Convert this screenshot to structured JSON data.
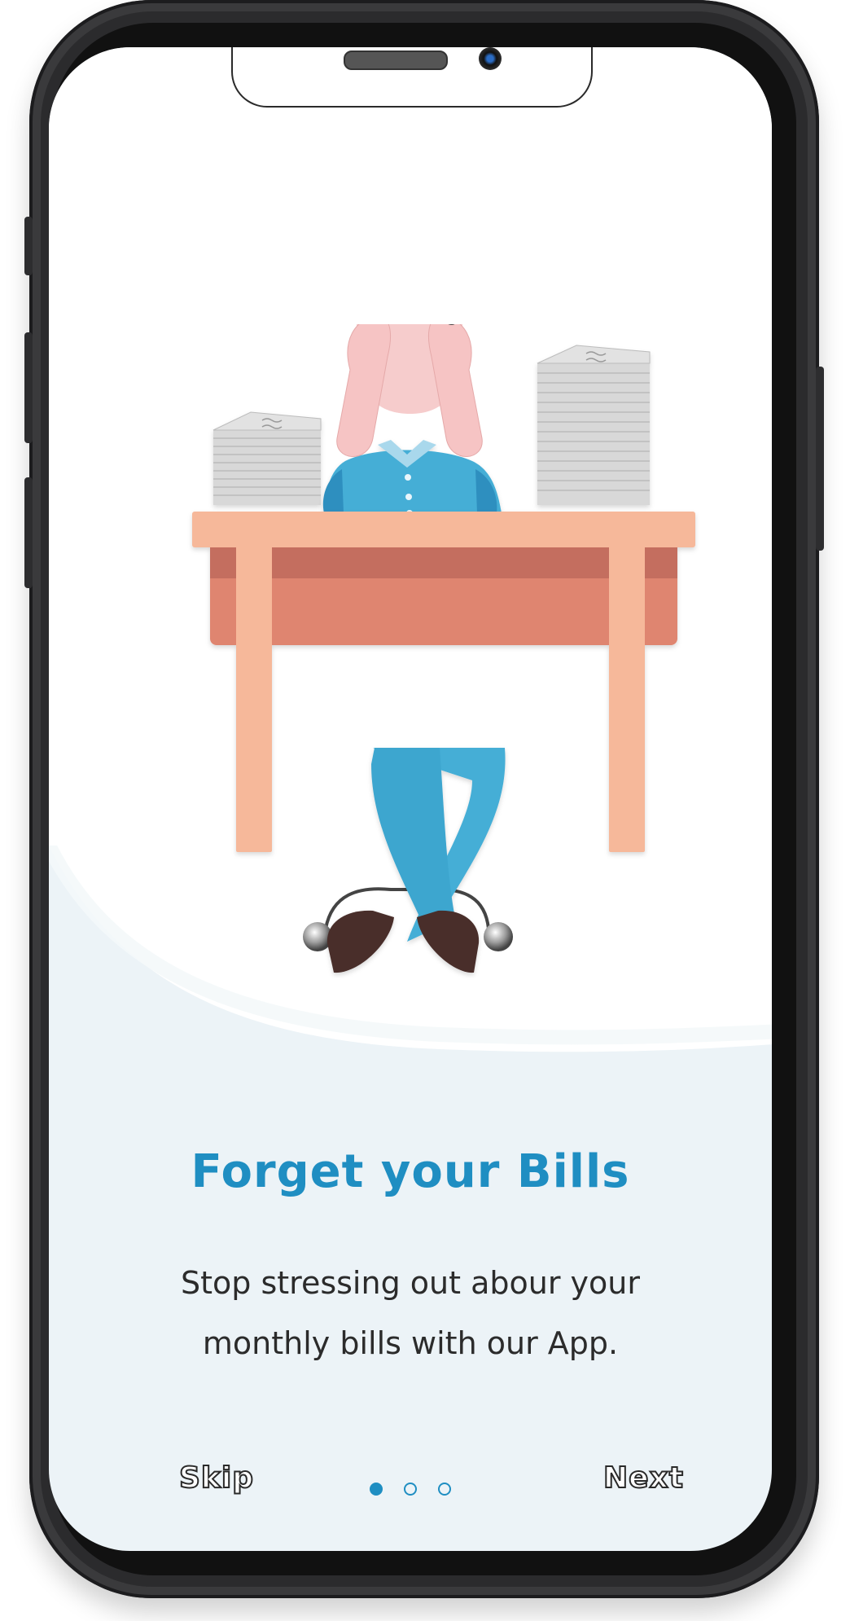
{
  "onboarding": {
    "title": "Forget your Bills",
    "subtitle": "Stop stressing out abour your monthly bills with our App.",
    "skip_label": "Skip",
    "next_label": "Next",
    "pagination": {
      "current": 1,
      "total": 3
    }
  },
  "colors": {
    "accent": "#1f8ec2",
    "screen_background": "#ecf3f7",
    "desk_top": "#f6b89a",
    "desk_front": "#df8570",
    "shirt": "#45aed6"
  },
  "illustration": {
    "icon": "stressed-man-at-desk-illustration"
  }
}
